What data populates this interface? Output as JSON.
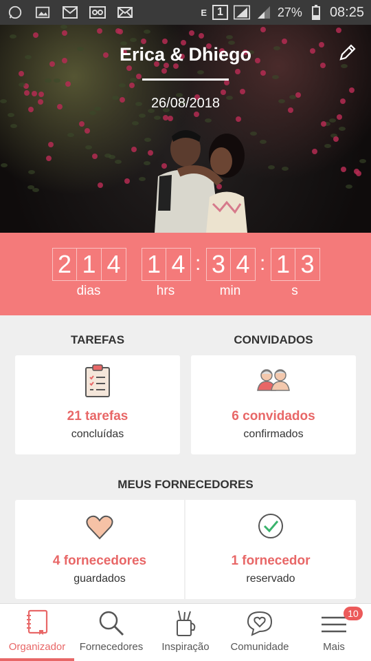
{
  "status_bar": {
    "battery": "27%",
    "time": "08:25",
    "sim": "1",
    "network": "E"
  },
  "hero": {
    "title": "Erica & Dhiego",
    "date": "26/08/2018"
  },
  "countdown": {
    "days": [
      "2",
      "1",
      "4"
    ],
    "hours": [
      "1",
      "4"
    ],
    "minutes": [
      "3",
      "4"
    ],
    "seconds": [
      "1",
      "3"
    ],
    "labels": {
      "days": "dias",
      "hours": "hrs",
      "minutes": "min",
      "seconds": "s"
    }
  },
  "sections": {
    "tasks_title": "TAREFAS",
    "guests_title": "CONVIDADOS",
    "vendors_title": "MEUS FORNECEDORES"
  },
  "cards": {
    "tasks": {
      "main": "21 tarefas",
      "sub": "concluídas",
      "icon": "clipboard-icon"
    },
    "guests": {
      "main": "6 convidados",
      "sub": "confirmados",
      "icon": "guests-icon"
    },
    "vendors_saved": {
      "main": "4 fornecedores",
      "sub": "guardados",
      "icon": "heart-icon"
    },
    "vendors_booked": {
      "main": "1 fornecedor",
      "sub": "reservado",
      "icon": "check-circle-icon"
    }
  },
  "nav": {
    "items": [
      {
        "label": "Organizador",
        "icon": "notebook-icon"
      },
      {
        "label": "Fornecedores",
        "icon": "search-icon"
      },
      {
        "label": "Inspiração",
        "icon": "inspiration-icon"
      },
      {
        "label": "Comunidade",
        "icon": "chat-heart-icon"
      },
      {
        "label": "Mais",
        "icon": "menu-icon"
      }
    ],
    "badge": "10"
  },
  "colors": {
    "accent": "#e86767",
    "countdown_bg": "#f47a7a"
  }
}
